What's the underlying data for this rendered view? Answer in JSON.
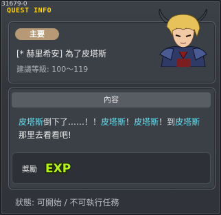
{
  "window": {
    "quest_id": "31679-0",
    "title": "QUEST INFO"
  },
  "quest": {
    "category": "主要",
    "name": "[* 赫里希安] 為了皮塔斯",
    "level": "建議等級: 100～119"
  },
  "content": {
    "header": "內容",
    "description": [
      {
        "text": "皮塔斯",
        "hl": true
      },
      {
        "text": "倒下了……！！",
        "hl": false
      },
      {
        "text": "皮塔斯",
        "hl": true
      },
      {
        "text": "！",
        "hl": false
      },
      {
        "text": "皮塔斯",
        "hl": true
      },
      {
        "text": "！到",
        "hl": false
      },
      {
        "text": "皮塔斯",
        "hl": true
      },
      {
        "text": "那里去看看吧!",
        "hl": false
      }
    ],
    "reward_label": "獎勵",
    "reward_icon": "exp-icon",
    "reward_icon_text": "EXP"
  },
  "status": "狀態:  可開始  / 不可執行任務",
  "colors": {
    "highlight": "#62e1f2",
    "title": "#ffd400",
    "pill": "#b79a75",
    "exp": "#b8f21b"
  }
}
